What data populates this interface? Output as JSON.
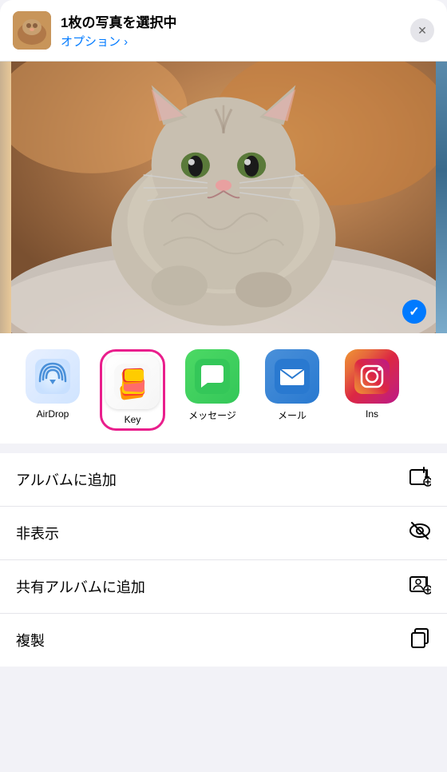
{
  "header": {
    "title": "1枚の写真を選択中",
    "option_label": "オプション ›",
    "close_label": "✕"
  },
  "photo": {
    "checkmark": "✓"
  },
  "apps": [
    {
      "id": "airdrop",
      "label": "AirDrop",
      "selected": false
    },
    {
      "id": "key",
      "label": "Key",
      "selected": true
    },
    {
      "id": "messages",
      "label": "メッセージ",
      "selected": false
    },
    {
      "id": "mail",
      "label": "メール",
      "selected": false
    },
    {
      "id": "instagram",
      "label": "Ins",
      "selected": false
    }
  ],
  "menu_items": [
    {
      "label": "アルバムに追加",
      "icon": "add-album"
    },
    {
      "label": "非表示",
      "icon": "hide"
    },
    {
      "label": "共有アルバムに追加",
      "icon": "shared-album"
    },
    {
      "label": "複製",
      "icon": "duplicate"
    }
  ],
  "colors": {
    "accent_blue": "#007aff",
    "accent_pink": "#e91e8c"
  }
}
